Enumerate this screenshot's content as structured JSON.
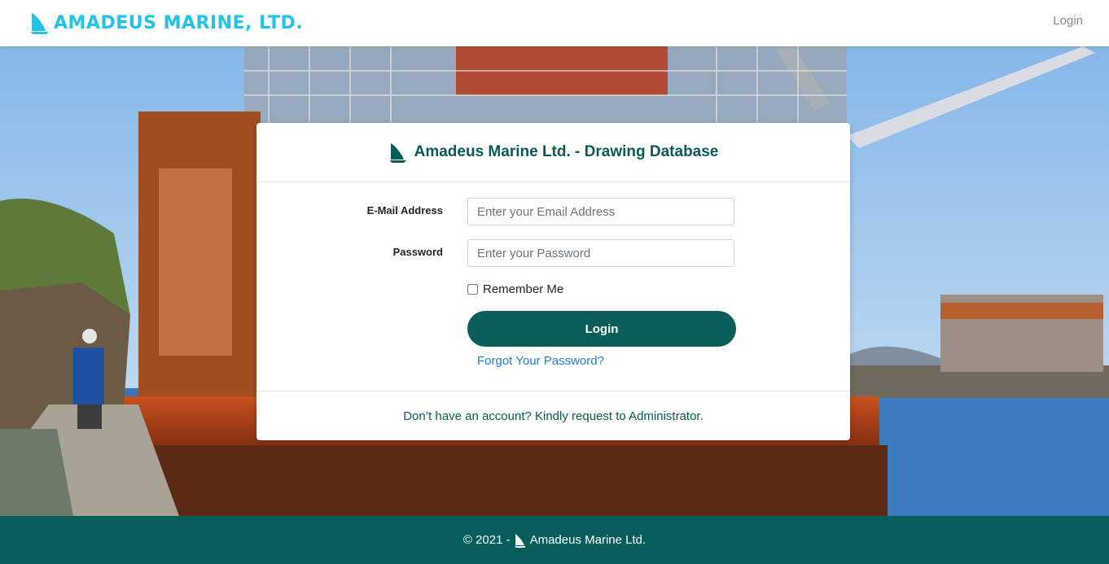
{
  "header": {
    "brand": "AMADEUS MARINE, LTD.",
    "brand_icon": "sail-fin-icon",
    "nav_login": "Login"
  },
  "card": {
    "title": "Amadeus Marine Ltd. - Drawing Database",
    "email_label": "E-Mail Address",
    "email_placeholder": "Enter your Email Address",
    "email_value": "",
    "password_label": "Password",
    "password_placeholder": "Enter your Password",
    "password_value": "",
    "remember_label": "Remember Me",
    "remember_checked": false,
    "login_button": "Login",
    "forgot_link": "Forgot Your Password?",
    "footer_text": "Don’t have an account? Kindly request to Administrator."
  },
  "footer": {
    "copyright": "© 2021 -",
    "company": "Amadeus Marine Ltd."
  },
  "colors": {
    "brand_cyan": "#22c3e6",
    "primary_teal": "#0a5f5a",
    "footer_teal": "#055e5a",
    "link_blue": "#1f7fd9"
  }
}
